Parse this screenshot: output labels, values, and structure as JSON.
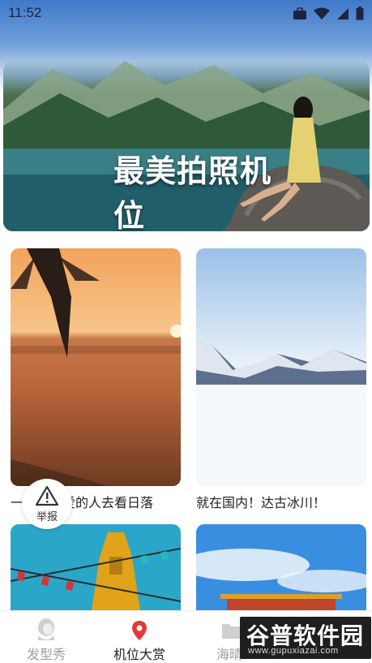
{
  "status": {
    "time": "11:52",
    "icons": [
      "briefcase-icon",
      "wifi-icon",
      "signal-icon",
      "battery-icon"
    ]
  },
  "banner": {
    "title": "最美拍照机位"
  },
  "cards": [
    {
      "caption": "一起和你爱的人去看日落"
    },
    {
      "caption": "就在国内！达古冰川！"
    }
  ],
  "report": {
    "label": "举报",
    "icon": "warning-icon"
  },
  "tabs": [
    {
      "label": "发型秀",
      "icon": "hairstyle-icon",
      "active": false
    },
    {
      "label": "机位大赏",
      "icon": "location-pin-icon",
      "active": true
    },
    {
      "label": "海晴",
      "icon": "folder-icon",
      "active": false
    }
  ],
  "watermark": {
    "title": "谷普软件园",
    "url": "www.gupuxiazai.com"
  },
  "colors": {
    "active_pin": "#e53935",
    "active_text": "#222222",
    "inactive_text": "#9e9e9e"
  }
}
